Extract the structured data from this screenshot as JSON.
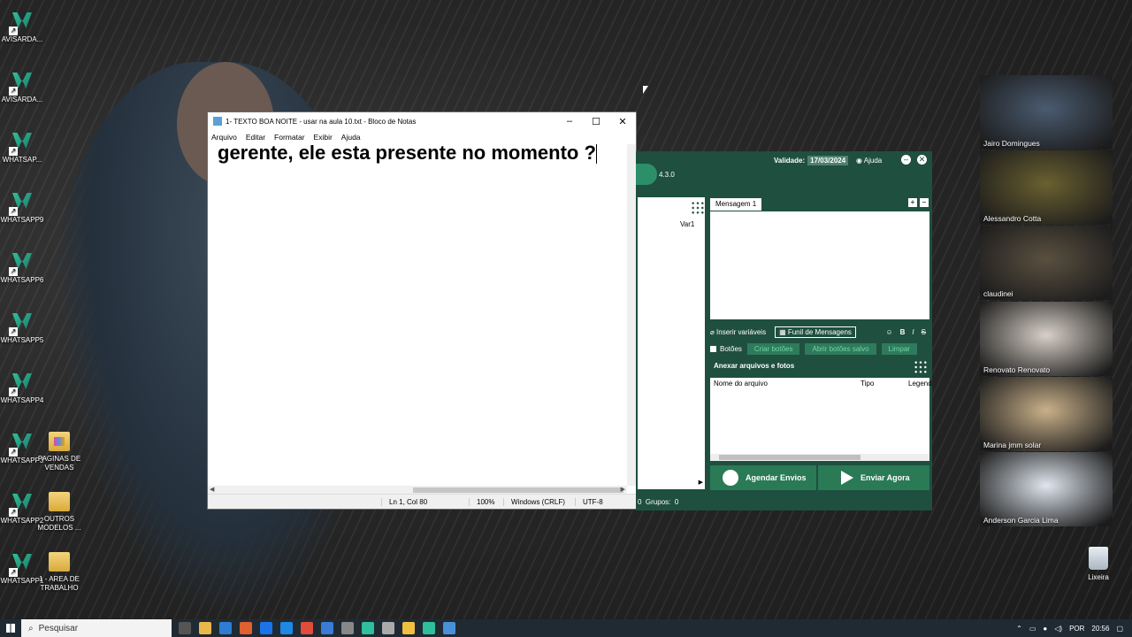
{
  "desktop_icons": [
    {
      "label": "AVISARDA...",
      "kind": "wa"
    },
    {
      "label": "AVISARDA...",
      "kind": "wa"
    },
    {
      "label": "WHATSAP...",
      "kind": "wa"
    },
    {
      "label": "WHATSAPP9",
      "kind": "wa"
    },
    {
      "label": "WHATSAPP6",
      "kind": "wa"
    },
    {
      "label": "WHATSAPP5",
      "kind": "wa"
    },
    {
      "label": "WHATSAPP4",
      "kind": "wa"
    },
    {
      "label": "WHATSAPP3",
      "kind": "wa"
    },
    {
      "label": "WHATSAPP2",
      "kind": "wa"
    },
    {
      "label": "WHATSAPP1",
      "kind": "wa"
    },
    {
      "label": "PAGINAS DE VENDAS",
      "kind": "folder"
    },
    {
      "label": "OUTROS MODELOS ...",
      "kind": "folder"
    },
    {
      "label": "1 - AREA DE TRABALHO",
      "kind": "folder"
    }
  ],
  "notepad": {
    "title": "1- TEXTO BOA NOITE - usar na aula 10.txt - Bloco de Notas",
    "menu": [
      "Arquivo",
      "Editar",
      "Formatar",
      "Exibir",
      "Ajuda"
    ],
    "content": "gerente, ele esta presente no momento ?",
    "status": {
      "position": "Ln 1, Col 80",
      "zoom": "100%",
      "line_ending": "Windows (CRLF)",
      "encoding": "UTF-8"
    }
  },
  "sender": {
    "version": "4.3.0",
    "validade_label": "Validade:",
    "validade_date": "17/03/2024",
    "help": "Ajuda",
    "var_label": "Var1",
    "tab": "Mensagem 1",
    "insert_vars": "Inserir variáveis",
    "funnel": "Funil de Mensagens",
    "format_buttons": [
      "B",
      "I",
      "S"
    ],
    "buttons_label": "Botões",
    "create_buttons": "Criar botões",
    "open_saved": "Abrir botões salvo",
    "clear": "Limpar",
    "attach_title": "Anexar arquivos e fotos",
    "table_headers": [
      "Nome do arquivo",
      "Tipo",
      "Legend"
    ],
    "schedule": "Agendar Envios",
    "send": "Enviar Agora",
    "footer_count": "0",
    "footer_groups_label": "Grupos:",
    "footer_groups": "0",
    "colors": {
      "panel": "#1f4f3f",
      "accent": "#2a7a56"
    }
  },
  "participants": [
    {
      "name": "Jairo Domingues",
      "bg": "#4a5b70"
    },
    {
      "name": "Alessandro Cotta",
      "bg": "#6a6030"
    },
    {
      "name": "claudinei",
      "bg": "#5a5040"
    },
    {
      "name": "Renovato Renovato",
      "bg": "#d8d0c8"
    },
    {
      "name": "Marina jmm solar",
      "bg": "#c9b089"
    },
    {
      "name": "Anderson Garcia Lima",
      "bg": "#dfe6ee"
    }
  ],
  "recycle_bin": "Lixeira",
  "taskbar": {
    "search_placeholder": "Pesquisar",
    "app_colors": [
      "#555",
      "#e8b84a",
      "#2d7dd2",
      "#e06030",
      "#1a73e8",
      "#1e88e5",
      "#e34b3a",
      "#3a7bd5",
      "#888",
      "#2fbf9c",
      "#aaa",
      "#f0c040",
      "#2fbf9c",
      "#4a90d9"
    ],
    "language": "POR",
    "time": "20:56"
  }
}
